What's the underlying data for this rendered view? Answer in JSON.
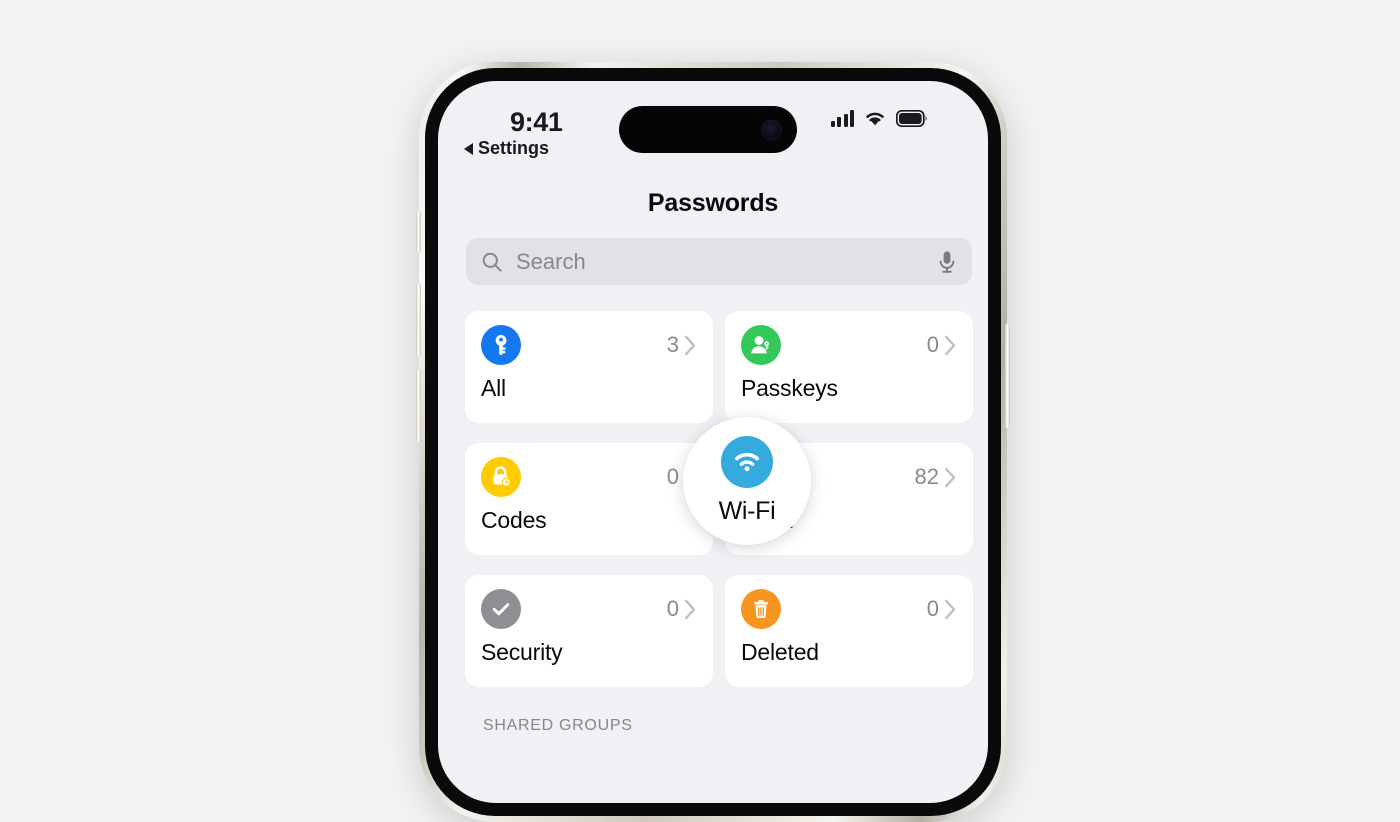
{
  "page": {
    "background_color": "#f2f2f3"
  },
  "phone": {
    "status_bar": {
      "time": "9:41",
      "back_label": "Settings",
      "back_icon": "back-triangle-icon",
      "cellular_icon": "cellular-bars-icon",
      "wifi_icon": "wifi-status-icon",
      "battery_icon": "battery-full-icon"
    },
    "nav": {
      "title": "Passwords"
    },
    "search": {
      "placeholder": "Search",
      "search_icon": "search-icon",
      "mic_icon": "microphone-icon"
    },
    "categories": [
      {
        "label": "All",
        "count": "3",
        "icon": "key-icon",
        "icon_color": "#1479f0",
        "chevron_icon": "chevron-right-icon"
      },
      {
        "label": "Passkeys",
        "count": "0",
        "icon": "person-key-icon",
        "icon_color": "#34c759",
        "chevron_icon": "chevron-right-icon"
      },
      {
        "label": "Codes",
        "count": "0",
        "icon": "lock-clock-icon",
        "icon_color": "#ffcc00",
        "chevron_icon": "chevron-right-icon"
      },
      {
        "label": "Wi-Fi",
        "count": "82",
        "icon": "wifi-icon",
        "icon_color": "#35aadf",
        "chevron_icon": "chevron-right-icon"
      },
      {
        "label": "Security",
        "count": "0",
        "icon": "checkmark-icon",
        "icon_color": "#8e8e93",
        "chevron_icon": "chevron-right-icon"
      },
      {
        "label": "Deleted",
        "count": "0",
        "icon": "trash-icon",
        "icon_color": "#f79520",
        "chevron_icon": "chevron-right-icon"
      }
    ],
    "sections": {
      "shared_groups_header": "SHARED GROUPS"
    },
    "spotlight": {
      "label": "Wi-Fi",
      "icon": "wifi-icon",
      "icon_color": "#35aadf"
    },
    "hardware": {
      "action_button": "action-button",
      "volume_up": "volume-up-button",
      "volume_down": "volume-down-button",
      "power_button": "power-button",
      "dynamic_island": "dynamic-island",
      "front_camera": "front-camera-icon"
    }
  }
}
